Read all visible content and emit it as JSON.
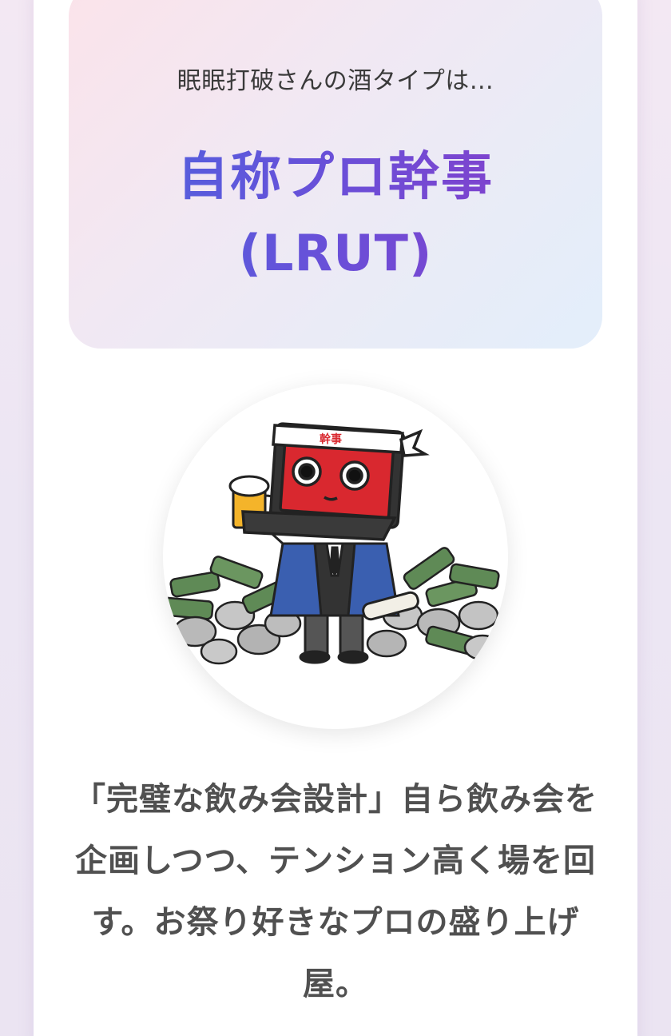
{
  "result": {
    "intro": "眠眠打破さんの酒タイプは…",
    "type_name": "自称プロ幹事",
    "type_code": "(LRUT)"
  },
  "character": {
    "icon": "laptop-party-organizer-illustration",
    "headband_text": "幹事"
  },
  "description": "「完璧な飲み会設計」自ら飲み会を企画しつつ、テンション高く場を回す。お祭り好きなプロの盛り上げ屋。",
  "colors": {
    "title_gradient_start": "#4a66e0",
    "title_gradient_end": "#8a3cc8",
    "box_gradient_start": "#fbe3ea",
    "box_gradient_end": "#e3eefb"
  }
}
